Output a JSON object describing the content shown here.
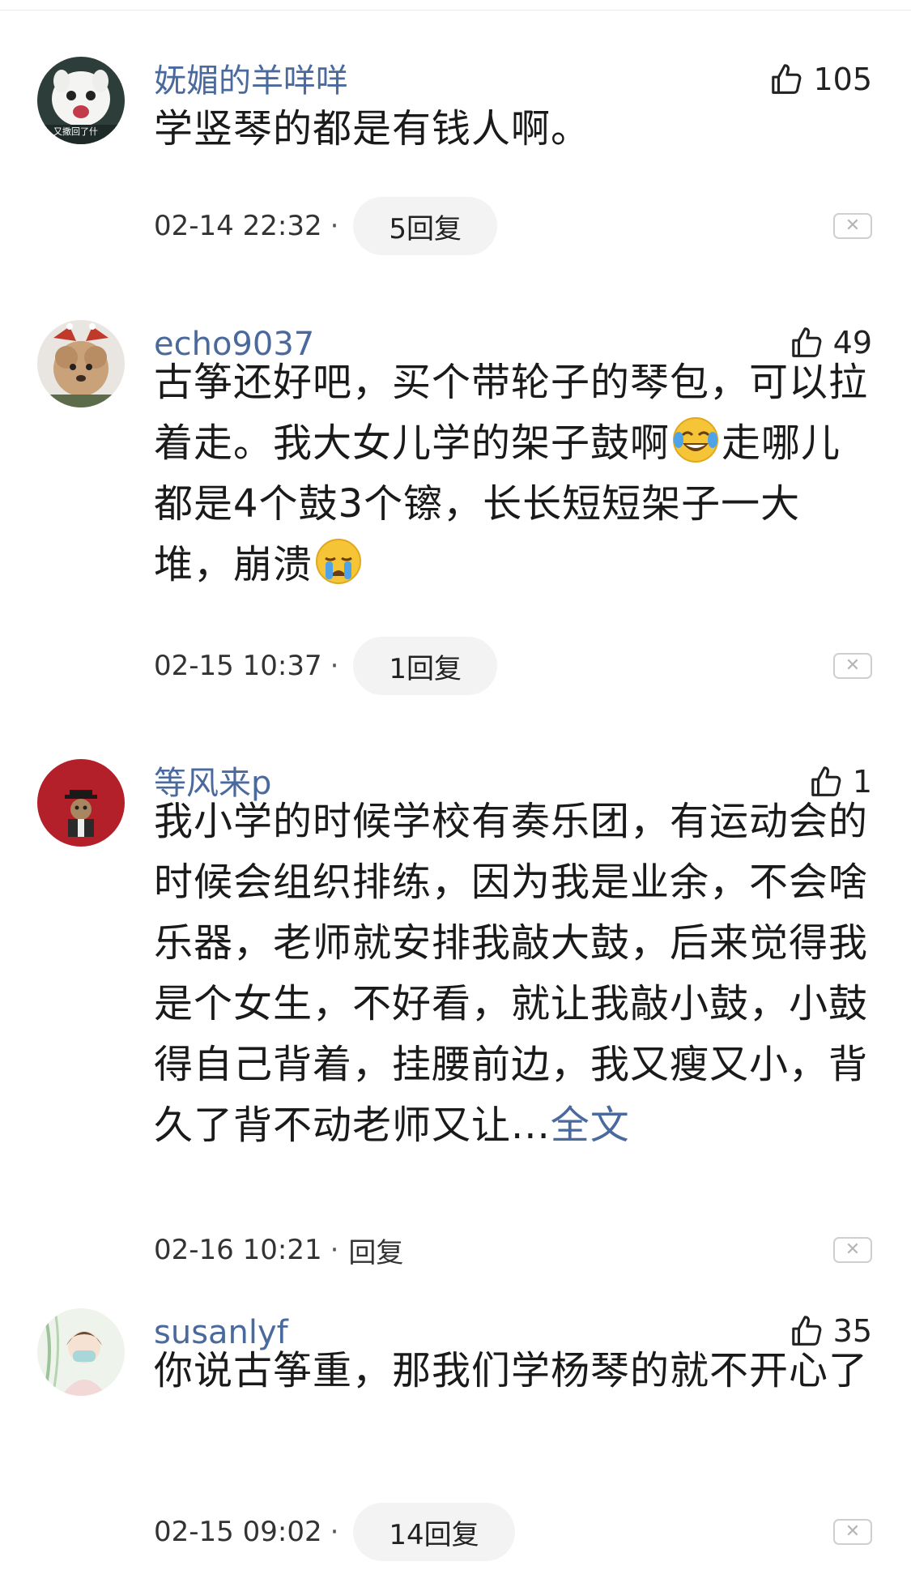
{
  "comments": [
    {
      "username": "妩媚的羊咩咩",
      "likes": "105",
      "text": "学竖琴的都是有钱人啊。",
      "time": "02-14 22:32",
      "reply_label": "5回复",
      "avatar_caption": "又撒回了什"
    },
    {
      "username": "echo9037",
      "likes": "49",
      "text_parts": [
        "古筝还好吧，买个带轮子的琴包，可以拉着走。我大女儿学的架子鼓啊",
        "走哪儿都是4个鼓3个镲，长长短短架子一大堆，崩溃"
      ],
      "time": "02-15 10:37",
      "reply_label": "1回复"
    },
    {
      "username": "等风来p",
      "likes": "1",
      "text": "我小学的时候学校有奏乐团，有运动会的时候会组织排练，因为我是业余，不会啥乐器，老师就安排我敲大鼓，后来觉得我是个女生，不好看，就让我敲小鼓，小鼓得自己背着，挂腰前边，我又瘦又小，背久了背不动老师又让...",
      "more_label": "全文",
      "time": "02-16 10:21",
      "reply_label": "回复"
    },
    {
      "username": "susanlyf",
      "likes": "35",
      "text": "你说古筝重，那我们学杨琴的就不开心了",
      "time": "02-15 09:02",
      "reply_label": "14回复"
    }
  ],
  "icons": {
    "like": "thumbs-up-icon",
    "close": "close-icon",
    "emoji_laugh_cry": "face-with-tears-of-joy",
    "emoji_cry": "crying-face"
  },
  "colors": {
    "username": "#4a6a9e",
    "link": "#4a6a9e",
    "pill_bg": "#f3f3f3",
    "text": "#1a1a1a"
  }
}
